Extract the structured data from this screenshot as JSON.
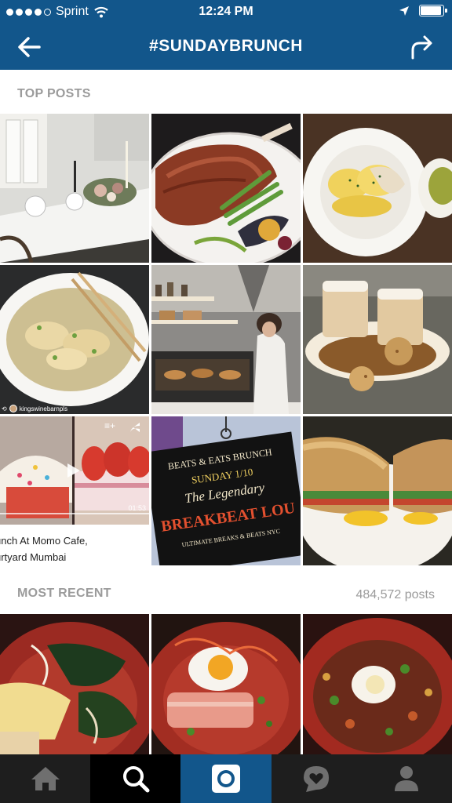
{
  "status_bar": {
    "carrier": "Sprint",
    "time": "12:24 PM",
    "battery_level": 0.85
  },
  "header": {
    "title": "#SUNDAYBRUNCH"
  },
  "sections": {
    "top_posts": {
      "label": "TOP POSTS"
    },
    "most_recent": {
      "label": "MOST RECENT",
      "count": "484,572 posts"
    }
  },
  "posts": {
    "repost_user": "kingswinebarnpls",
    "video_time": "01:53",
    "caption_line1": "unch At Momo Cafe,",
    "caption_line2": "urtyard Mumbai",
    "sign_lines": [
      "BEATS & EATS BRUNCH",
      "SUNDAY 1/10",
      "The Legendary",
      "BREAKBEAT LOU",
      "ULTIMATE BREAKS & BEATS NYC"
    ]
  },
  "tabbar": {
    "items": [
      "home",
      "search",
      "camera",
      "activity",
      "profile"
    ]
  },
  "colors": {
    "brand": "#12568b",
    "tabbar": "#1e1e1e",
    "label": "#9b9b9b"
  }
}
